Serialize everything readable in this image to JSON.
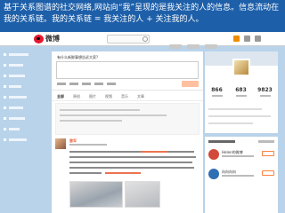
{
  "slide": {
    "banner_text": "基于关系图谱的社交网络,网站向“我”呈现的是我关注的人的信息。信息流动在我的关系链。我的关系链 = 我关注的人 + 关注我的人。"
  },
  "app": {
    "logo_text": "微博"
  },
  "composer": {
    "prompt": "有什么新鲜事想告诉大家?"
  },
  "filter_tabs": [
    "全部",
    "原创",
    "图片",
    "视频",
    "音乐",
    "文章"
  ],
  "feed": {
    "author": "雷军"
  },
  "profile": {
    "name": "",
    "stats": [
      "866",
      "683",
      "9823"
    ]
  },
  "suggestions": [
    {
      "name": "Helen的微博",
      "avatar_color": "#d24a3a"
    },
    {
      "name": "向向向向",
      "avatar_color": "#2f6fb3"
    }
  ],
  "colors": {
    "slide_blue": "#1d5fa9",
    "weibo_red": "#e6162d",
    "accent_orange": "#eb7350"
  }
}
